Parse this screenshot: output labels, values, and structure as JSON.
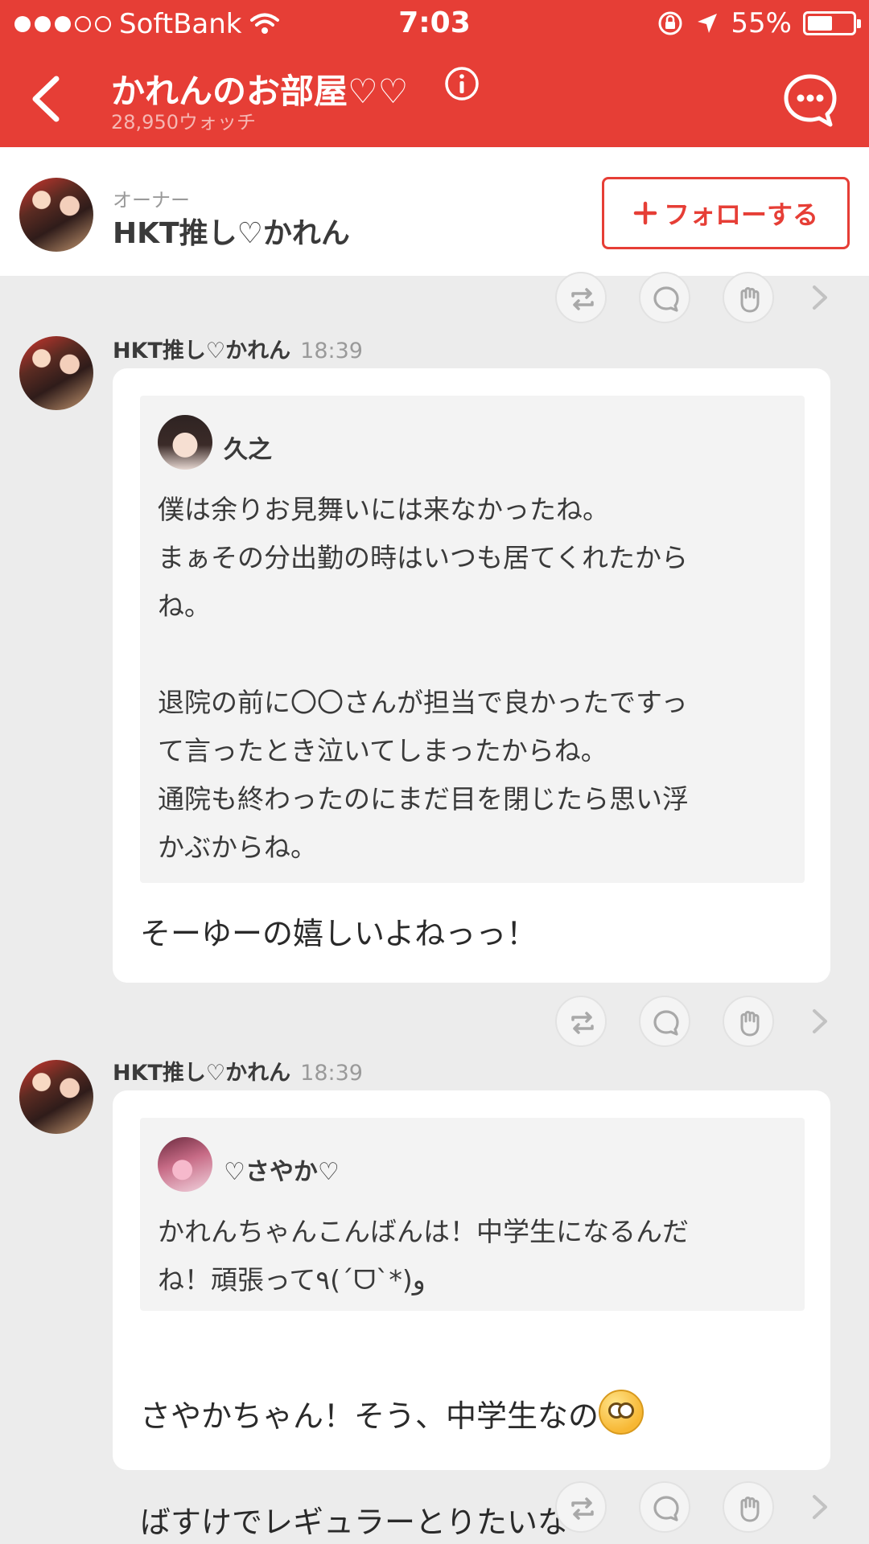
{
  "status_bar": {
    "carrier": "SoftBank",
    "time": "7:03",
    "battery": "55%"
  },
  "header": {
    "title": "かれんのお部屋♡♡",
    "watch_count": "28,950ウォッチ"
  },
  "owner": {
    "label": "オーナー",
    "name": "HKT推し♡かれん",
    "follow_label": "フォローする"
  },
  "posts": [
    {
      "author": "HKT推し♡かれん",
      "time": "18:39",
      "quote": {
        "author": "久之",
        "text": "僕は余りお見舞いには来なかったね。\nまぁその分出勤の時はいつも居てくれたから\nね。\n\n退院の前に〇〇さんが担当で良かったですっ\nて言ったとき泣いてしまったからね。\n通院も終わったのにまだ目を閉じたら思い浮\nかぶからね。"
      },
      "text": "そーゆーの嬉しいよねっっ！"
    },
    {
      "author": "HKT推し♡かれん",
      "time": "18:39",
      "quote": {
        "author": "♡さやか♡",
        "text": "かれんちゃんこんばんは！中学生になるんだ\nね！頑張って٩(ˊᗜˋ*)و"
      },
      "text_line1": "さやかちゃん！そう、中学生なの",
      "text_emoji": "flushed-face-emoji",
      "text_line2": "ばすけでレギュラーとりたいな"
    }
  ],
  "icons": {
    "repost": "repost-icon",
    "comment": "comment-icon",
    "applause": "clap-hand-icon",
    "more": "chevron-right-icon"
  },
  "colors": {
    "brand_red": "#e63e36",
    "background": "#ececec",
    "quote_bg": "#f3f3f3"
  }
}
